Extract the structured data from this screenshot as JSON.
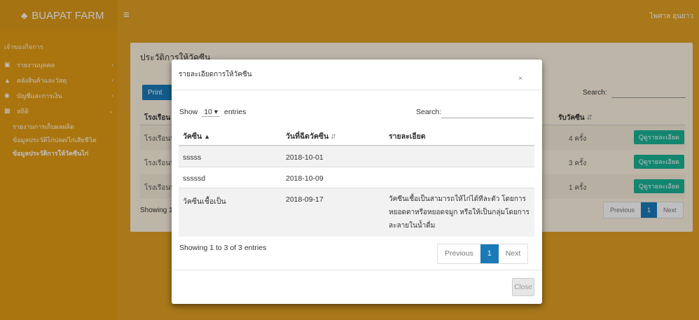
{
  "app": {
    "brand": "BUAPAT FARM",
    "username": "ไพศาล อุนยาว"
  },
  "sidebar": {
    "header": "เจ้าของกิจการ",
    "items": [
      {
        "label": "รายงานบุคคล",
        "icon": "id-card-icon"
      },
      {
        "label": "คลังสินค้าและวัสดุ",
        "icon": "bank-icon"
      },
      {
        "label": "บัญชีและการเงิน",
        "icon": "money-icon"
      },
      {
        "label": "สถิติ",
        "icon": "chart-icon"
      }
    ],
    "subitems": [
      "รายงานการเก็บผลผลิต",
      "ข้อมูลประวัติไก่ปลด/ไก่เสียชีวิต",
      "ข้อมูลประวัติการให้วัคซีนไก่"
    ]
  },
  "page": {
    "title": "ประวัติการให้วัคซีน",
    "print_label": "Print",
    "search_label": "Search:",
    "col_house": "โรงเรือน",
    "col_count": "รับวัคซีน",
    "rows": [
      {
        "house": "โรงเรือนที่",
        "count": "4 ครั้ง",
        "button": "ดูรายละเอียด"
      },
      {
        "house": "โรงเรือนที่",
        "count": "3 ครั้ง",
        "button": "ดูรายละเอียด"
      },
      {
        "house": "โรงเรือนที่",
        "count": "1 ครั้ง",
        "button": "ดูรายละเอียด"
      }
    ],
    "showing": "Showing 1",
    "pager": {
      "prev": "Previous",
      "page": "1",
      "next": "Next"
    }
  },
  "modal": {
    "title": "รายละเอียดการให้วัคซีน",
    "close_x": "×",
    "length": {
      "show": "Show",
      "value": "10",
      "caret": "▾",
      "entries": "entries"
    },
    "search_label": "Search:",
    "columns": {
      "vaccine": "วัคซีน",
      "date": "วันที่ฉีดวัคซีน",
      "detail": "รายละเอียด"
    },
    "rows": [
      {
        "vaccine": "sssss",
        "date": "2018-10-01",
        "detail": ""
      },
      {
        "vaccine": "sssssd",
        "date": "2018-10-09",
        "detail": ""
      },
      {
        "vaccine": "วัคซีนเชื้อเป็น",
        "date": "2018-09-17",
        "detail": "วัคซีนเชื้อเป็นสามารถให้ไก่ได้ทีละตัว โดยการหยอดตาหรือหยอดจมูก หรือให้เป็นกลุ่มโดยการละลายในน้ำดื่ม"
      }
    ],
    "showing": "Showing 1 to 3 of 3 entries",
    "pager": {
      "prev": "Previous",
      "page": "1",
      "next": "Next"
    },
    "close_button": "Close"
  }
}
